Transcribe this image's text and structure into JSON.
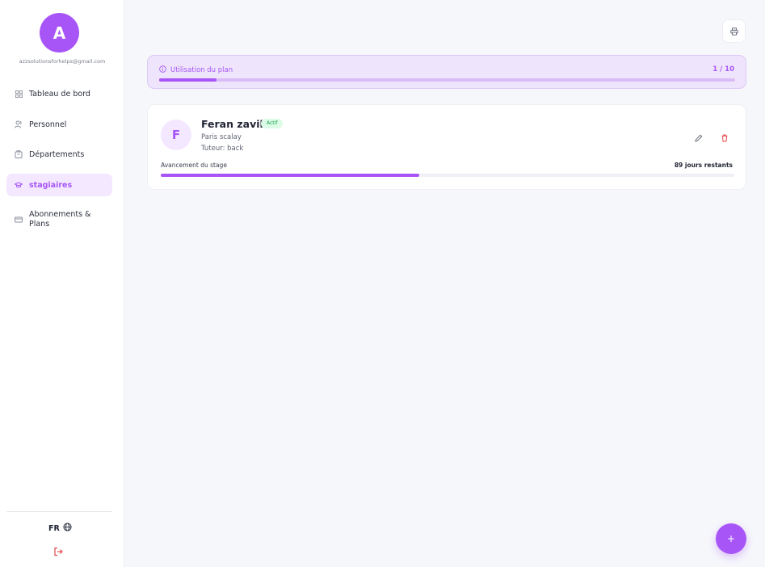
{
  "user": {
    "avatar_initial": "A",
    "email": "azzsolutionsforhelps@gmail.com"
  },
  "nav": {
    "items": [
      {
        "label": "Tableau de bord",
        "icon": "grid-icon"
      },
      {
        "label": "Personnel",
        "icon": "users-icon"
      },
      {
        "label": "Départements",
        "icon": "building-icon"
      },
      {
        "label": "stagiaires",
        "icon": "graduation-cap-icon",
        "active": true
      },
      {
        "label": "Abonnements & Plans",
        "icon": "credit-card-icon"
      }
    ]
  },
  "footer": {
    "language": "FR",
    "language_icon": "globe-icon",
    "logout_icon": "logout-icon"
  },
  "toolbar": {
    "print_icon": "printer-icon"
  },
  "plan": {
    "title": "Utilisation du plan",
    "count": "1 / 10",
    "used": 1,
    "limit": 10
  },
  "interns": [
    {
      "initial": "F",
      "name": "Feran zavik",
      "status": "Actif",
      "company": "Paris scalay",
      "tutor": "Tuteur: back",
      "progress_label": "Avancement du stage",
      "remaining": "89 jours restants",
      "progress_fraction": 0.45
    }
  ],
  "fab": {
    "label": "+"
  },
  "colors": {
    "accent": "#a855f7",
    "accent_light": "#f3e8ff",
    "success": "#16a34a",
    "danger": "#e5484d"
  }
}
